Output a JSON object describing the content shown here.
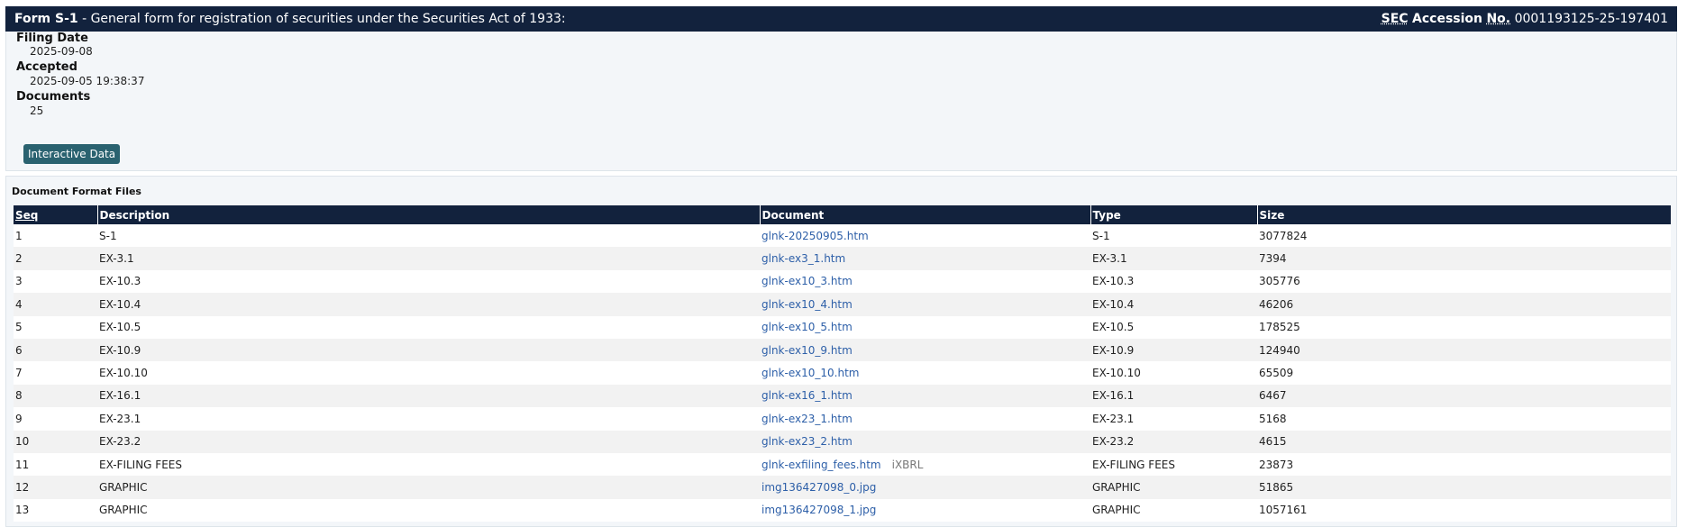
{
  "header": {
    "form_label": "Form S-1",
    "form_desc": " - General form for registration of securities under the Securities Act of 1933:",
    "acc_abbr_1": "SEC",
    "acc_word": "Accession",
    "acc_abbr_2": "No.",
    "acc_number": "0001193125-25-197401"
  },
  "info": {
    "filing_date_label": "Filing Date",
    "filing_date_value": "2025-09-08",
    "accepted_label": "Accepted",
    "accepted_value": "2025-09-05 19:38:37",
    "documents_label": "Documents",
    "documents_value": "25",
    "interactive_button": "Interactive Data"
  },
  "files": {
    "title": "Document Format Files",
    "headers": {
      "seq": "Seq",
      "description": "Description",
      "document": "Document",
      "type": "Type",
      "size": "Size"
    },
    "rows": [
      {
        "seq": "1",
        "description": "S-1",
        "document": "glnk-20250905.htm",
        "extra": "",
        "type": "S-1",
        "size": "3077824"
      },
      {
        "seq": "2",
        "description": "EX-3.1",
        "document": "glnk-ex3_1.htm",
        "extra": "",
        "type": "EX-3.1",
        "size": "7394"
      },
      {
        "seq": "3",
        "description": "EX-10.3",
        "document": "glnk-ex10_3.htm",
        "extra": "",
        "type": "EX-10.3",
        "size": "305776"
      },
      {
        "seq": "4",
        "description": "EX-10.4",
        "document": "glnk-ex10_4.htm",
        "extra": "",
        "type": "EX-10.4",
        "size": "46206"
      },
      {
        "seq": "5",
        "description": "EX-10.5",
        "document": "glnk-ex10_5.htm",
        "extra": "",
        "type": "EX-10.5",
        "size": "178525"
      },
      {
        "seq": "6",
        "description": "EX-10.9",
        "document": "glnk-ex10_9.htm",
        "extra": "",
        "type": "EX-10.9",
        "size": "124940"
      },
      {
        "seq": "7",
        "description": "EX-10.10",
        "document": "glnk-ex10_10.htm",
        "extra": "",
        "type": "EX-10.10",
        "size": "65509"
      },
      {
        "seq": "8",
        "description": "EX-16.1",
        "document": "glnk-ex16_1.htm",
        "extra": "",
        "type": "EX-16.1",
        "size": "6467"
      },
      {
        "seq": "9",
        "description": "EX-23.1",
        "document": "glnk-ex23_1.htm",
        "extra": "",
        "type": "EX-23.1",
        "size": "5168"
      },
      {
        "seq": "10",
        "description": "EX-23.2",
        "document": "glnk-ex23_2.htm",
        "extra": "",
        "type": "EX-23.2",
        "size": "4615"
      },
      {
        "seq": "11",
        "description": "EX-FILING FEES",
        "document": "glnk-exfiling_fees.htm",
        "extra": "iXBRL",
        "type": "EX-FILING FEES",
        "size": "23873"
      },
      {
        "seq": "12",
        "description": "GRAPHIC",
        "document": "img136427098_0.jpg",
        "extra": "",
        "type": "GRAPHIC",
        "size": "51865"
      },
      {
        "seq": "13",
        "description": "GRAPHIC",
        "document": "img136427098_1.jpg",
        "extra": "",
        "type": "GRAPHIC",
        "size": "1057161"
      }
    ]
  }
}
